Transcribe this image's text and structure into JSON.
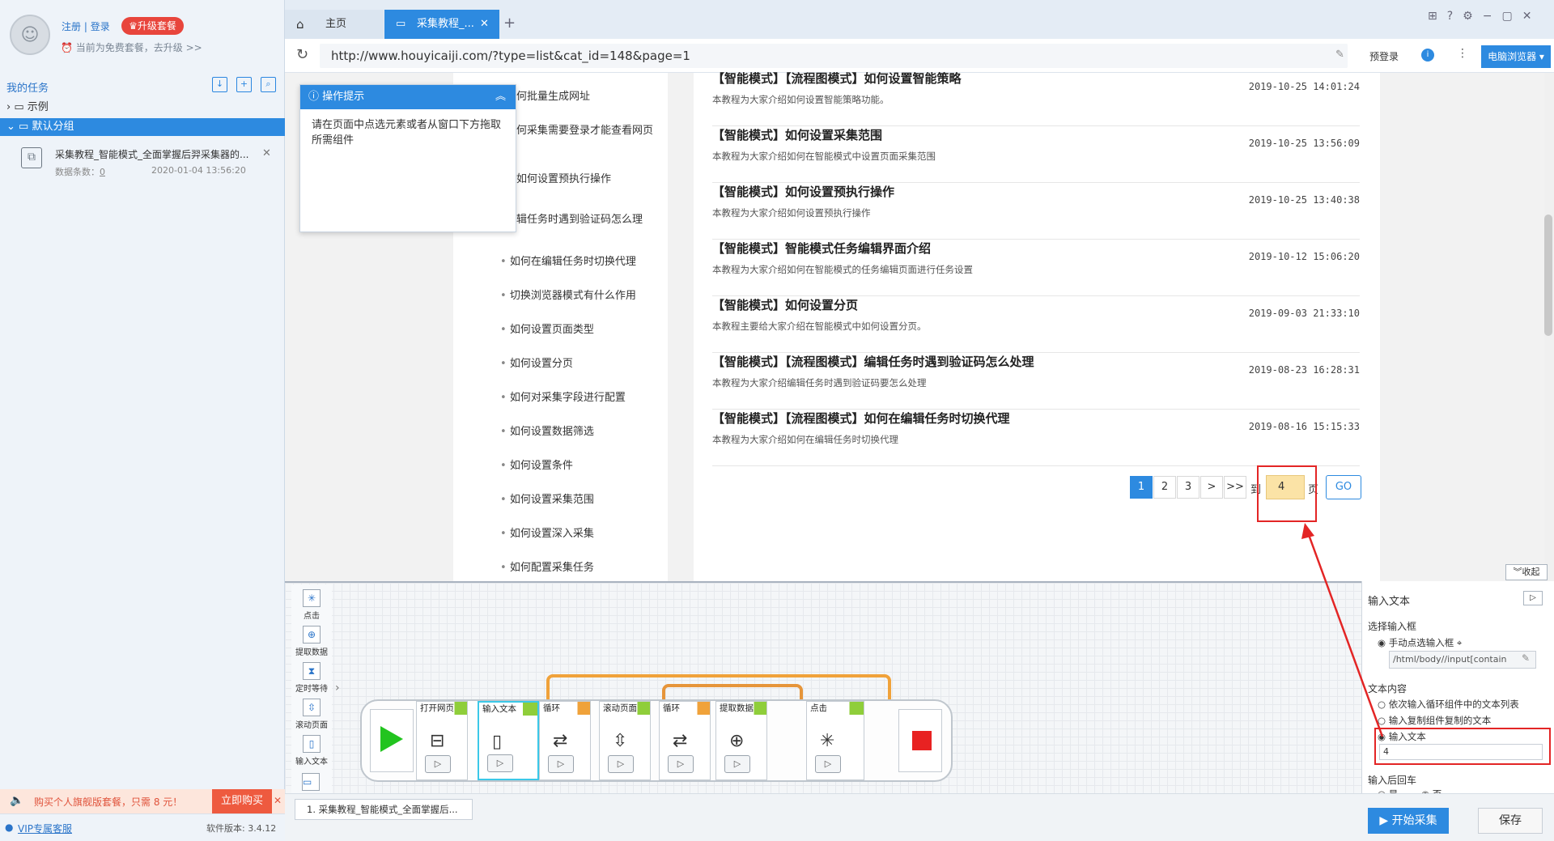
{
  "user": {
    "register": "注册",
    "sep": "|",
    "login": "登录",
    "upgrade": "升级套餐",
    "plan_text": "当前为免费套餐，去升级 >>"
  },
  "tasks": {
    "header": "我的任务",
    "group1": "示例",
    "group2": "默认分组",
    "task_name": "采集教程_智能模式_全面掌握后羿采集器的...",
    "count_label": "数据条数：",
    "count_value": "0",
    "task_time": "2020-01-04 13:56:20"
  },
  "promo": {
    "text": "购买个人旗舰版套餐，只需 8 元！",
    "buy": "立即购买"
  },
  "footer": {
    "vip": "VIP专属客服",
    "version": "软件版本: 3.4.12"
  },
  "browser": {
    "tab_home": "主页",
    "tab_active": "采集教程_...",
    "url": "http://www.houyicaiji.com/?type=list&cat_id=148&page=1",
    "prelogin": "预登录",
    "pc_browser": "电脑浏览器"
  },
  "tip": {
    "title": "操作提示",
    "body": "请在页面中点选元素或者从窗口下方拖取所需组件"
  },
  "sidebar_links": [
    "何批量生成网址",
    "何采集需要登录才能查看网页",
    "如何设置预执行操作",
    "辑任务时遇到验证码怎么理",
    "如何在编辑任务时切换代理",
    "切换浏览器模式有什么作用",
    "如何设置页面类型",
    "如何设置分页",
    "如何对采集字段进行配置",
    "如何设置数据筛选",
    "如何设置条件",
    "如何设置采集范围",
    "如何设置深入采集",
    "如何配置采集任务"
  ],
  "articles": [
    {
      "title": "【智能模式】【流程图模式】如何设置智能策略",
      "desc": "本教程为大家介绍如何设置智能策略功能。",
      "date": "2019-10-25 14:01:24"
    },
    {
      "title": "【智能模式】如何设置采集范围",
      "desc": "本教程为大家介绍如何在智能模式中设置页面采集范围",
      "date": "2019-10-25 13:56:09"
    },
    {
      "title": "【智能模式】如何设置预执行操作",
      "desc": "本教程为大家介绍如何设置预执行操作",
      "date": "2019-10-25 13:40:38"
    },
    {
      "title": "【智能模式】智能模式任务编辑界面介绍",
      "desc": "本教程为大家介绍如何在智能模式的任务编辑页面进行任务设置",
      "date": "2019-10-12 15:06:20"
    },
    {
      "title": "【智能模式】如何设置分页",
      "desc": "本教程主要给大家介绍在智能模式中如何设置分页。",
      "date": "2019-09-03 21:33:10"
    },
    {
      "title": "【智能模式】【流程图模式】编辑任务时遇到验证码怎么处理",
      "desc": "本教程为大家介绍编辑任务时遇到验证码要怎么处理",
      "date": "2019-08-23 16:28:31"
    },
    {
      "title": "【智能模式】【流程图模式】如何在编辑任务时切换代理",
      "desc": "本教程为大家介绍如何在编辑任务时切换代理",
      "date": "2019-08-16 15:15:33"
    }
  ],
  "pagination": {
    "pages": [
      "1",
      "2",
      "3",
      ">",
      ">>"
    ],
    "to": "到",
    "input": "4",
    "page": "页",
    "go": "GO"
  },
  "palette": [
    "点击",
    "提取数据",
    "定时等待",
    "滚动页面",
    "输入文本"
  ],
  "flow_nodes": [
    "打开网页",
    "输入文本",
    "循环",
    "滚动页面",
    "循环",
    "提取数据",
    "点击"
  ],
  "right_panel": {
    "collapse": "收起",
    "title": "输入文本",
    "select_label": "选择输入框",
    "manual": "手动点选输入框",
    "xpath": "/html/body//input[contain",
    "content_label": "文本内容",
    "opt1": "依次输入循环组件中的文本列表",
    "opt2": "输入复制组件复制的文本",
    "opt3": "输入文本",
    "input_value": "4",
    "enter_label": "输入后回车",
    "yes": "是",
    "no": "否"
  },
  "bottom": {
    "run_tab": "1. 采集教程_智能模式_全面掌握后...",
    "start": "开始采集",
    "save": "保存"
  }
}
